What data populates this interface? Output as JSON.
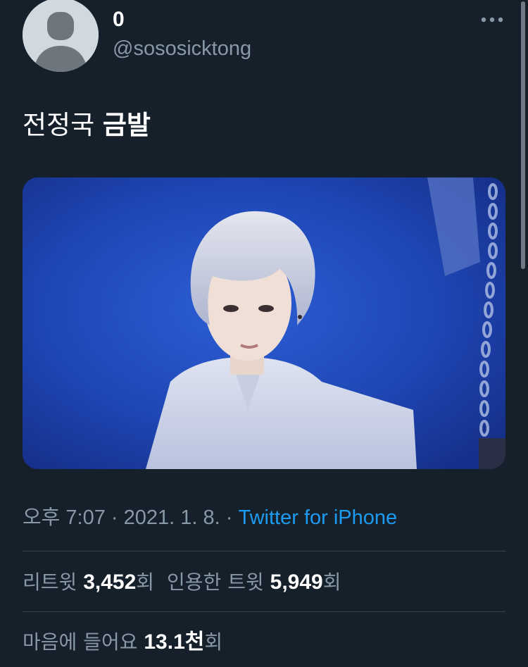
{
  "author": {
    "display_name": "0",
    "handle": "@sososicktong"
  },
  "tweet": {
    "text_regular": "전정국 ",
    "text_bold": "금발"
  },
  "meta": {
    "time": "오후 7:07",
    "separator": " · ",
    "date": "2021. 1. 8.",
    "source": "Twitter for iPhone"
  },
  "stats": {
    "retweets_label_prefix": "리트윗 ",
    "retweets_count": "3,452",
    "retweets_label_suffix": "회",
    "quotes_label_prefix": "인용한 트윗 ",
    "quotes_count": "5,949",
    "quotes_label_suffix": "회",
    "likes_label_prefix": "마음에 들어요 ",
    "likes_count": "13.1천",
    "likes_label_suffix": "회"
  },
  "icons": {
    "avatar": "default-avatar-icon",
    "more": "more-options-icon"
  },
  "colors": {
    "background": "#15202b",
    "secondary_text": "#8899a6",
    "link": "#1d9bf0",
    "divider": "#38444d"
  }
}
